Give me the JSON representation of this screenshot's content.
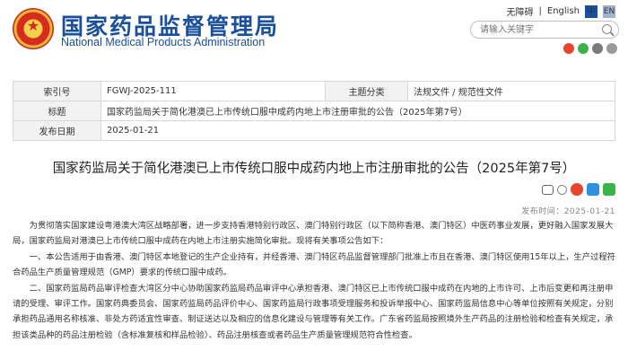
{
  "header": {
    "title_cn": "国家药品监督管理局",
    "title_en": "National Medical Products Administration",
    "links": [
      "无障碍",
      "|",
      "English"
    ],
    "lang_zh": "中",
    "lang_en": "EN",
    "search_placeholder": "请输入关键字",
    "icons": [
      "emblem",
      "search-icon",
      "weibo-icon",
      "wechat-icon",
      "mobile-icon",
      "share-icon"
    ]
  },
  "info": {
    "index_label": "索引号",
    "index_value": "FGWJ-2025-111",
    "topic_label": "主题分类",
    "topic_value": "法规文件 / 规范性文件",
    "title_label": "标题",
    "title_value": "国家药监局关于简化港澳已上市传统口服中成药内地上市注册审批的公告（2025年第7号）",
    "date_label": "发布日期",
    "date_value": "2025-01-21"
  },
  "article": {
    "headline": "国家药监局关于简化港澳已上市传统口服中成药内地上市注册审批的公告（2025年第7号）",
    "date": "发布时间：2025-01-21",
    "paragraphs": [
      "为贯彻落实国家建设粤港澳大湾区战略部署，进一步支持香港特别行政区、澳门特别行政区（以下简称香港、澳门特区）中医药事业发展，更好融入国家发展大局，国家药监局对港澳已上市传统口服中成药在内地上市注册实施简化审批。现将有关事项公告如下：",
      "一、本公告适用于由香港、澳门特区本地登记的生产企业持有，并经香港、澳门特区药品监督管理部门批准上市且在香港、澳门特区使用15年以上，生产过程符合药品生产质量管理规范（GMP）要求的传统口服中成药。",
      "二、国家药监局药品审评检查大湾区分中心协助国家药监局药品审评中心承担香港、澳门特区已上市传统口服中成药在内地的上市许可、上市后变更和再注册申请的受理、审评工作。国家药典委员会、国家药监局药品评价中心、国家药监局行政事项受理服务和投诉举报中心、国家药监局信息中心等单位按照有关规定，分别承担药品通用名称核准、非处方药适宜性审查、制证送达以及相应的信息化建设与管理等有关工作。广东省药监局按照境外生产药品的注册检验和检查有关规定，承担该类品种的药品注册检验（含标准复核和样品检验）、药品注册核查或者药品生产质量管理规范符合性检查。"
    ]
  },
  "colors": {
    "brand_blue": "#1a4f9c",
    "emblem_red": "#d62c1f",
    "emblem_gold": "#f5d04a"
  }
}
